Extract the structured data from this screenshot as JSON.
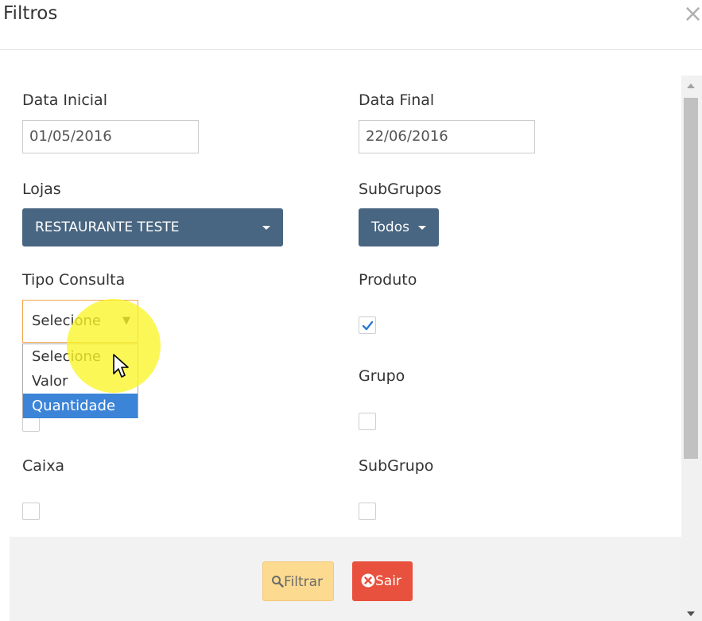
{
  "header": {
    "title": "Filtros",
    "close_glyph": "×"
  },
  "form": {
    "data_inicial": {
      "label": "Data Inicial",
      "value": "01/05/2016"
    },
    "data_final": {
      "label": "Data Final",
      "value": "22/06/2016"
    },
    "lojas": {
      "label": "Lojas",
      "selected": "RESTAURANTE TESTE"
    },
    "subgrupos": {
      "label": "SubGrupos",
      "selected": "Todos"
    },
    "tipo_consulta": {
      "label": "Tipo Consulta",
      "selected": "Selecione",
      "arrow": "▼",
      "options": [
        "Selecione",
        "Valor",
        "Quantidade"
      ],
      "highlighted_option": "Quantidade"
    },
    "produto": {
      "label": "Produto",
      "checked": true
    },
    "grupo": {
      "label": "Grupo",
      "checked": false
    },
    "caixa": {
      "label": "Caixa",
      "checked": false
    },
    "subgrupo": {
      "label": "SubGrupo",
      "checked": false
    },
    "hidden_checkbox": {
      "checked": false
    }
  },
  "footer": {
    "filtrar_label": "Filtrar",
    "sair_label": "Sair"
  },
  "icons": {
    "close": "close-icon",
    "search": "search-icon",
    "cancel": "times-circle-icon",
    "check": "check-icon",
    "caret": "caret-down-icon",
    "cursor": "mouse-cursor-icon"
  },
  "colors": {
    "dropdown_bg": "#486581",
    "select_focus_border": "#f0a44a",
    "option_highlight": "#3b84d8",
    "check_color": "#2e7ad1",
    "filtrar_bg": "#fcda8f",
    "sair_bg": "#e8513d",
    "click_highlight": "#faf528"
  }
}
